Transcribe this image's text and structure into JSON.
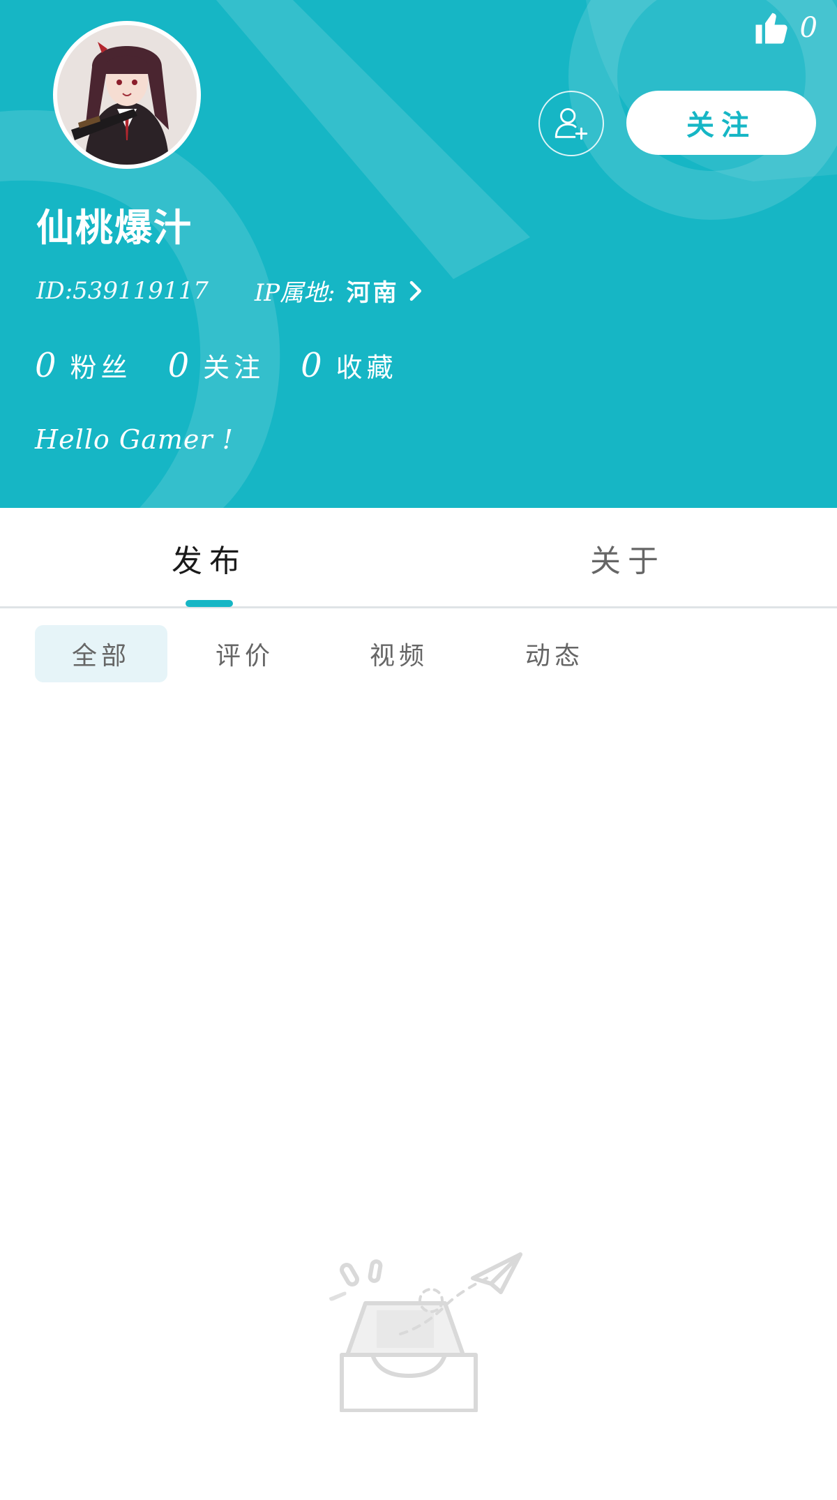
{
  "header": {
    "like_count": "0",
    "follow_label": "关注",
    "username": "仙桃爆汁",
    "id_text": "ID:539119117",
    "ip_label": "IP属地:",
    "ip_value": "河南",
    "bio": "Hello Gamer !",
    "stats": [
      {
        "num": "0",
        "label": "粉丝"
      },
      {
        "num": "0",
        "label": "关注"
      },
      {
        "num": "0",
        "label": "收藏"
      }
    ]
  },
  "tabs": [
    {
      "label": "发布",
      "active": true
    },
    {
      "label": "关于",
      "active": false
    }
  ],
  "filters": [
    {
      "label": "全部",
      "selected": true
    },
    {
      "label": "评价",
      "selected": false
    },
    {
      "label": "视频",
      "selected": false
    },
    {
      "label": "动态",
      "selected": false
    }
  ],
  "colors": {
    "accent": "#16b6c5",
    "chip_selected_bg": "#e6f4f8",
    "text_dark": "#1a1a1a",
    "text_muted": "#666666"
  },
  "icons": [
    "thumbs-up-icon",
    "add-friend-icon",
    "chevron-right-icon",
    "empty-inbox-icon"
  ]
}
